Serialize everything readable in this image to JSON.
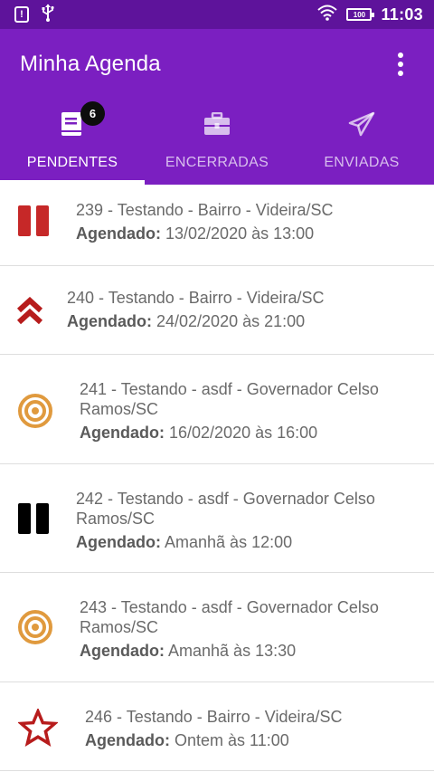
{
  "status_bar": {
    "time": "11:03",
    "battery": "100",
    "alert_glyph": "!",
    "icons": [
      "alert-icon",
      "usb-icon",
      "wifi-icon",
      "battery-icon"
    ]
  },
  "app_bar": {
    "title": "Minha Agenda",
    "color": "#7b1fc1"
  },
  "tabs": [
    {
      "label": "PENDENTES",
      "icon": "book-icon",
      "badge": "6",
      "active": true
    },
    {
      "label": "ENCERRADAS",
      "icon": "briefcase-icon",
      "active": false
    },
    {
      "label": "ENVIADAS",
      "icon": "send-icon",
      "active": false
    }
  ],
  "items": [
    {
      "title": "239 -  Testando - Bairro - Videira/SC",
      "sched_label": "Agendado:",
      "sched_value": " 13/02/2020 às 13:00",
      "icon": "pause-icon",
      "icon_color": "#c62828"
    },
    {
      "title": "240 -  Testando - Bairro - Videira/SC",
      "sched_label": "Agendado:",
      "sched_value": " 24/02/2020 às 21:00",
      "icon": "double-chevron-up-icon",
      "icon_color": "#b71c1c"
    },
    {
      "title": "241 -  Testando - asdf - Governador Celso Ramos/SC",
      "sched_label": "Agendado:",
      "sched_value": " 16/02/2020 às 16:00",
      "icon": "target-icon",
      "icon_color": "#e09a3e"
    },
    {
      "title": "242 -  Testando - asdf - Governador Celso Ramos/SC",
      "sched_label": "Agendado:",
      "sched_value": " Amanhã às 12:00",
      "icon": "pause-icon",
      "icon_color": "#000000"
    },
    {
      "title": "243 -  Testando - asdf - Governador Celso Ramos/SC",
      "sched_label": "Agendado:",
      "sched_value": " Amanhã às 13:30",
      "icon": "target-icon",
      "icon_color": "#e09a3e"
    },
    {
      "title": "246 -  Testando - Bairro - Videira/SC",
      "sched_label": "Agendado:",
      "sched_value": " Ontem às 11:00",
      "icon": "star-outline-icon",
      "icon_color": "#b71c1c"
    }
  ]
}
